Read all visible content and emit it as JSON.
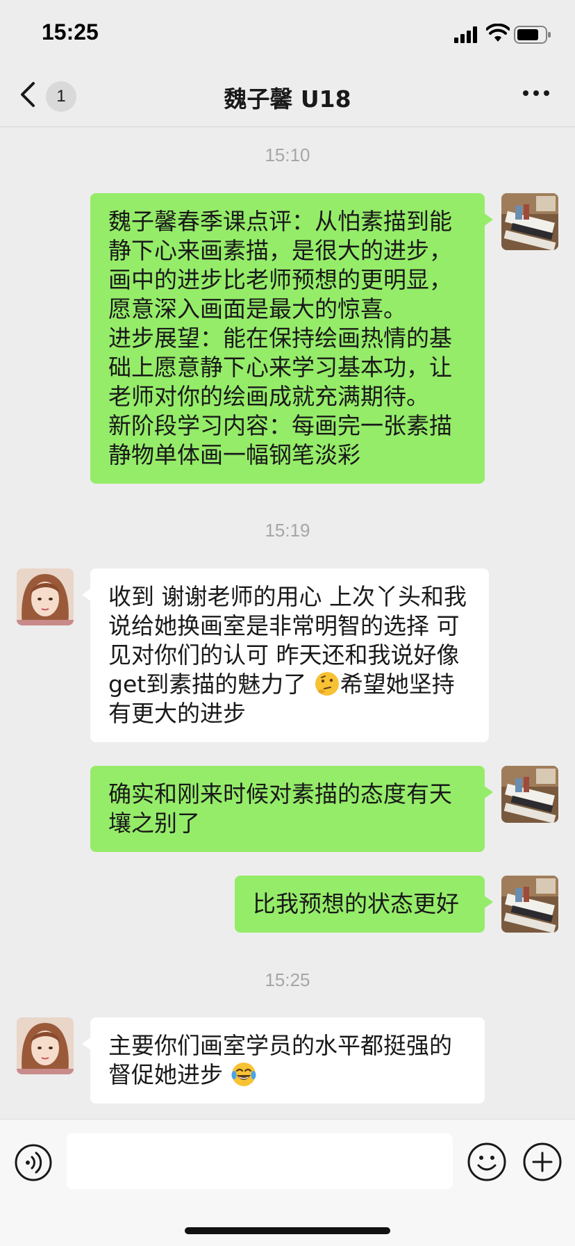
{
  "status_bar": {
    "time": "15:25"
  },
  "header": {
    "back_count": "1",
    "title": "魏子馨 U18",
    "more_icon": "more-dots-icon"
  },
  "timestamps": [
    "15:10",
    "15:19",
    "15:25"
  ],
  "messages": [
    {
      "side": "out",
      "text": "魏子馨春季课点评：从怕素描到能静下心来画素描，是很大的进步，画中的进步比老师预想的更明显，愿意深入画面是最大的惊喜。\n进步展望：能在保持绘画热情的基础上愿意静下心来学习基本功，让老师对你的绘画成就充满期待。\n新阶段学习内容：每画完一张素描静物单体画一幅钢笔淡彩"
    },
    {
      "side": "in",
      "text_before_emoji": "收到 谢谢老师的用心 上次丫头和我说给她换画室是非常明智的选择 可见对你们的认可 昨天还和我说好像get到素描的魅力了 ",
      "emoji": "thinking-face-emoji",
      "text_after_emoji": "希望她坚持有更大的进步"
    },
    {
      "side": "out",
      "text": "确实和刚来时候对素描的态度有天壤之别了"
    },
    {
      "side": "out",
      "text": "比我预想的状态更好"
    },
    {
      "side": "in",
      "text_before_emoji": "主要你们画室学员的水平都挺强的 督促她进步 ",
      "emoji": "tears-of-joy-emoji",
      "text_after_emoji": ""
    }
  ],
  "colors": {
    "outgoing_bubble": "#95ec69",
    "incoming_bubble": "#ffffff",
    "background": "#ededed",
    "timestamp": "#a6a6a6"
  },
  "input_bar": {
    "voice_icon": "voice-icon",
    "emoji_icon": "emoji-face-icon",
    "plus_icon": "plus-icon",
    "value": ""
  }
}
